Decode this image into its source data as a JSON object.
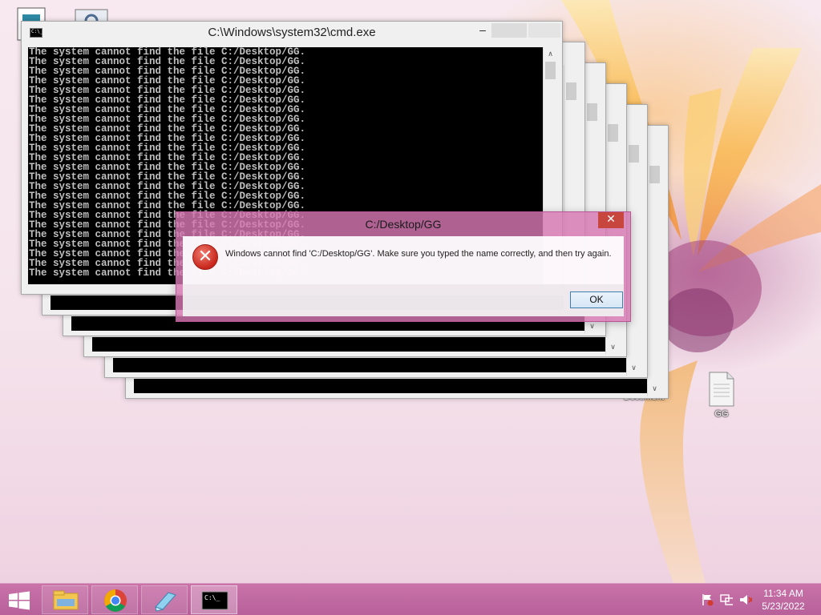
{
  "cmd_window": {
    "title": "C:\\Windows\\system32\\cmd.exe",
    "icon_text": "C:\\_",
    "output_line": "The system cannot find the file C:/Desktop/GG.",
    "line_count": 24
  },
  "dialog": {
    "title": "C:/Desktop/GG",
    "close_symbol": "✕",
    "message": "Windows cannot find 'C:/Desktop/GG'. Make sure you typed the name correctly, and then try again.",
    "ok_label": "OK"
  },
  "desktop_icons": {
    "gg_label": "GG",
    "document_label": "Document"
  },
  "taskbar": {
    "time": "11:34 AM",
    "date": "5/23/2022",
    "items": [
      "file-explorer-icon",
      "chrome-icon",
      "notepad-icon",
      "cmd-icon"
    ]
  },
  "colors": {
    "accent": "#c06ba2",
    "dialog_frame": "#d678b2",
    "close_red": "#c7463e",
    "console_bg": "#000000",
    "console_text": "#c0c0c0"
  }
}
